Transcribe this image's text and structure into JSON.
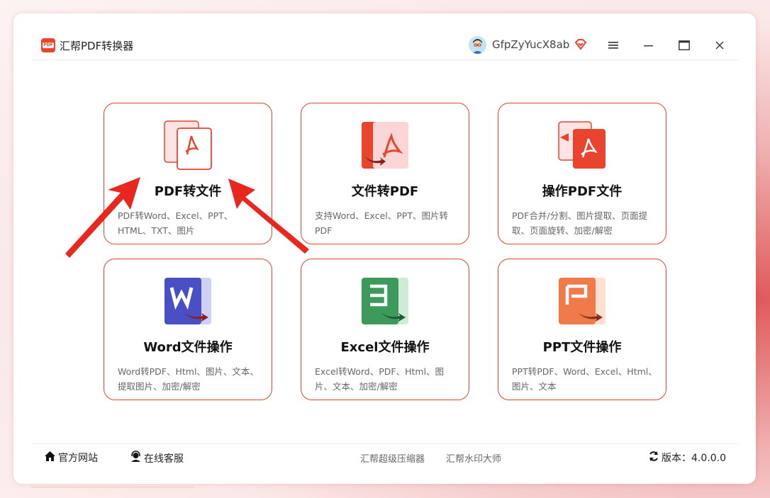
{
  "app": {
    "title": "汇帮PDF转换器",
    "logo_text": "PDF"
  },
  "user": {
    "name": "GfpZyYucX8ab"
  },
  "icons": {
    "menu": "menu-icon",
    "minimize": "minimize-icon",
    "maximize": "maximize-icon",
    "close": "close-icon",
    "vip": "vip-diamond-icon"
  },
  "cards": [
    {
      "title": "PDF转文件",
      "desc": "PDF转Word、Excel、PPT、HTML、TXT、图片",
      "icon": "pdf-to-file-icon",
      "color": "#e8442e"
    },
    {
      "title": "文件转PDF",
      "desc": "支持Word、Excel、PPT、图片转PDF",
      "icon": "file-to-pdf-icon",
      "color": "#e8442e"
    },
    {
      "title": "操作PDF文件",
      "desc": "PDF合并/分割、图片提取、页面提取、页面旋转、加密/解密",
      "icon": "operate-pdf-icon",
      "color": "#e8442e"
    },
    {
      "title": "Word文件操作",
      "desc": "Word转PDF、Html、图片、文本、提取图片、加密/解密",
      "icon": "word-icon",
      "color": "#4b4fc4"
    },
    {
      "title": "Excel文件操作",
      "desc": "Excel转Word、PDF、Html、图片、文本、加密/解密",
      "icon": "excel-icon",
      "color": "#3e9a5c"
    },
    {
      "title": "PPT文件操作",
      "desc": "PPT转PDF、Word、Excel、Html、图片、文本",
      "icon": "ppt-icon",
      "color": "#f07b4a"
    }
  ],
  "footer": {
    "official_site": "官方网站",
    "online_service": "在线客服",
    "link1": "汇帮超级压缩器",
    "link2": "汇帮水印大师",
    "version": "版本：4.0.0.0"
  }
}
